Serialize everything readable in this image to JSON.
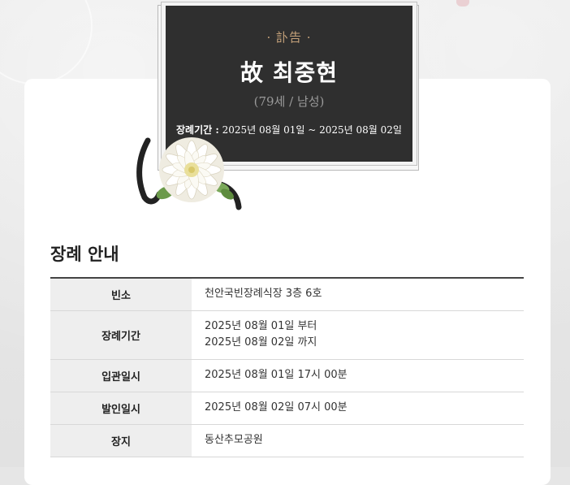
{
  "plaque": {
    "tag": "· 訃告 ·",
    "name": "故 최중현",
    "age": "(79세 / 남성)",
    "period_label": "장례기간 :",
    "period_value": "2025년 08월 01일 ~ 2025년 08월 02일"
  },
  "section": {
    "title": "장례 안내"
  },
  "info": {
    "rows": [
      {
        "label": "빈소",
        "value": "천안국빈장례식장 3층 6호"
      },
      {
        "label": "장례기간",
        "line1": "2025년 08월 01일 부터",
        "line2": "2025년 08월 02일 까지"
      },
      {
        "label": "입관일시",
        "value": "2025년 08월 01일 17시 00분"
      },
      {
        "label": "발인일시",
        "value": "2025년 08월 02일 07시 00분"
      },
      {
        "label": "장지",
        "value": "동산추모공원"
      }
    ]
  },
  "colors": {
    "plaque_bg": "#2f2f2f",
    "accent_gold": "#c5a27a",
    "page_bg": "#e6e6e6"
  }
}
